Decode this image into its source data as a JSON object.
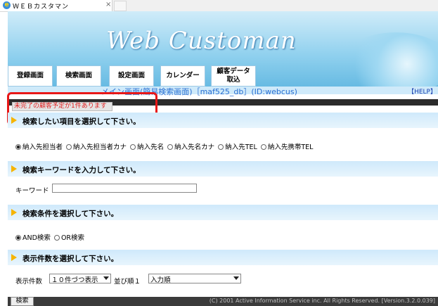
{
  "browser": {
    "tab_title": "ＷＥＢカスタマン",
    "close_glyph": "×"
  },
  "header": {
    "brand": "Web Customan",
    "nav": [
      {
        "label": "登録画面"
      },
      {
        "label": "検索画面"
      },
      {
        "label": "設定画面"
      },
      {
        "label": "カレンダー"
      },
      {
        "label_line1": "顧客データ",
        "label_line2": "取込"
      }
    ],
    "info": "メイン画面(簡易検索画面)［maf525_db］(ID:webcus)",
    "help": "【HELP】"
  },
  "notice": "未完了の顧客予定が1件あります",
  "sections": {
    "item": "検索したい項目を選択して下さい。",
    "keyword": "検索キーワードを入力して下さい。",
    "condition": "検索条件を選択して下さい。",
    "count": "表示件数を選択して下さい。"
  },
  "item_options": [
    {
      "label": "納入先担当者",
      "selected": true
    },
    {
      "label": "納入先担当者カナ",
      "selected": false
    },
    {
      "label": "納入先名",
      "selected": false
    },
    {
      "label": "納入先名カナ",
      "selected": false
    },
    {
      "label": "納入先TEL",
      "selected": false
    },
    {
      "label": "納入先携帯TEL",
      "selected": false
    }
  ],
  "keyword": {
    "label": "キーワード",
    "value": ""
  },
  "condition_options": [
    {
      "label": "AND検索",
      "selected": true
    },
    {
      "label": "OR検索",
      "selected": false
    }
  ],
  "display": {
    "count_label": "表示件数",
    "count_value": "１０件づつ表示",
    "sort_label": "並び順１",
    "sort_value": "入力順"
  },
  "footer": {
    "search_button": "検索",
    "copyright": "(C) 2001 Active Information Service inc. All Rights Reserved. [Version.3.2.0.039]"
  },
  "colors": {
    "accent_red": "#e81717",
    "section_bg": "#cfe9fb",
    "triangle": "#f6b400"
  }
}
